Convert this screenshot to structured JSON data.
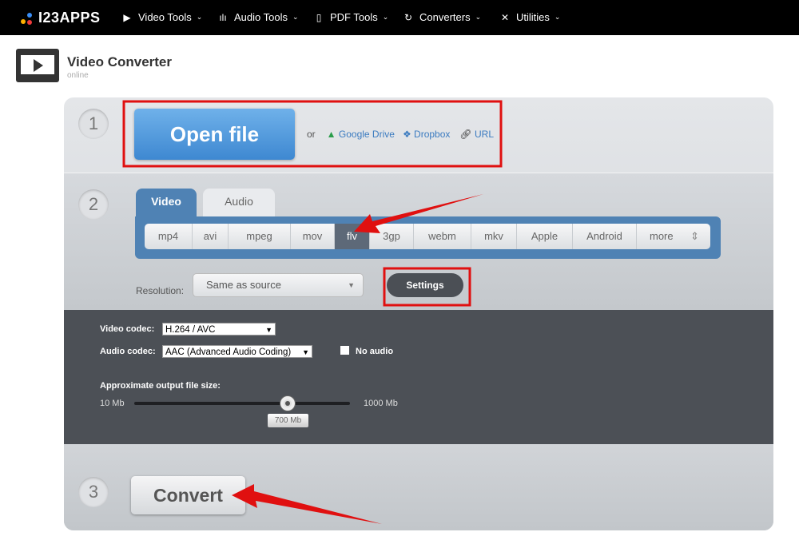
{
  "nav": {
    "logo": "I23APPS",
    "items": [
      {
        "label": "Video Tools",
        "icon": "play-square-icon"
      },
      {
        "label": "Audio Tools",
        "icon": "waveform-icon"
      },
      {
        "label": "PDF Tools",
        "icon": "document-icon"
      },
      {
        "label": "Converters",
        "icon": "refresh-icon"
      },
      {
        "label": "Utilities",
        "icon": "tools-icon"
      }
    ]
  },
  "header": {
    "title": "Video Converter",
    "subtitle": "online"
  },
  "step1": {
    "num": "1",
    "open_file": "Open file",
    "or": "or",
    "google_drive": "Google Drive",
    "dropbox": "Dropbox",
    "url": "URL"
  },
  "step2": {
    "num": "2",
    "tabs": [
      "Video",
      "Audio"
    ],
    "formats": [
      "mp4",
      "avi",
      "mpeg",
      "mov",
      "flv",
      "3gp",
      "webm",
      "mkv",
      "Apple",
      "Android",
      "more"
    ],
    "selected_format": "flv",
    "resolution_label": "Resolution:",
    "resolution_value": "Same as source",
    "settings": "Settings"
  },
  "advanced": {
    "video_codec_label": "Video codec:",
    "video_codec": "H.264 / AVC",
    "audio_codec_label": "Audio codec:",
    "audio_codec": "AAC (Advanced Audio Coding)",
    "no_audio": "No audio",
    "no_audio_checked": false,
    "size_label": "Approximate output file size:",
    "min": "10 Mb",
    "max": "1000 Mb",
    "value": "700 Mb"
  },
  "step3": {
    "num": "3",
    "convert": "Convert"
  },
  "colors": {
    "accent_blue": "#4f82b4",
    "open_button": "#4a94dc",
    "annotation_red": "#e01010"
  }
}
